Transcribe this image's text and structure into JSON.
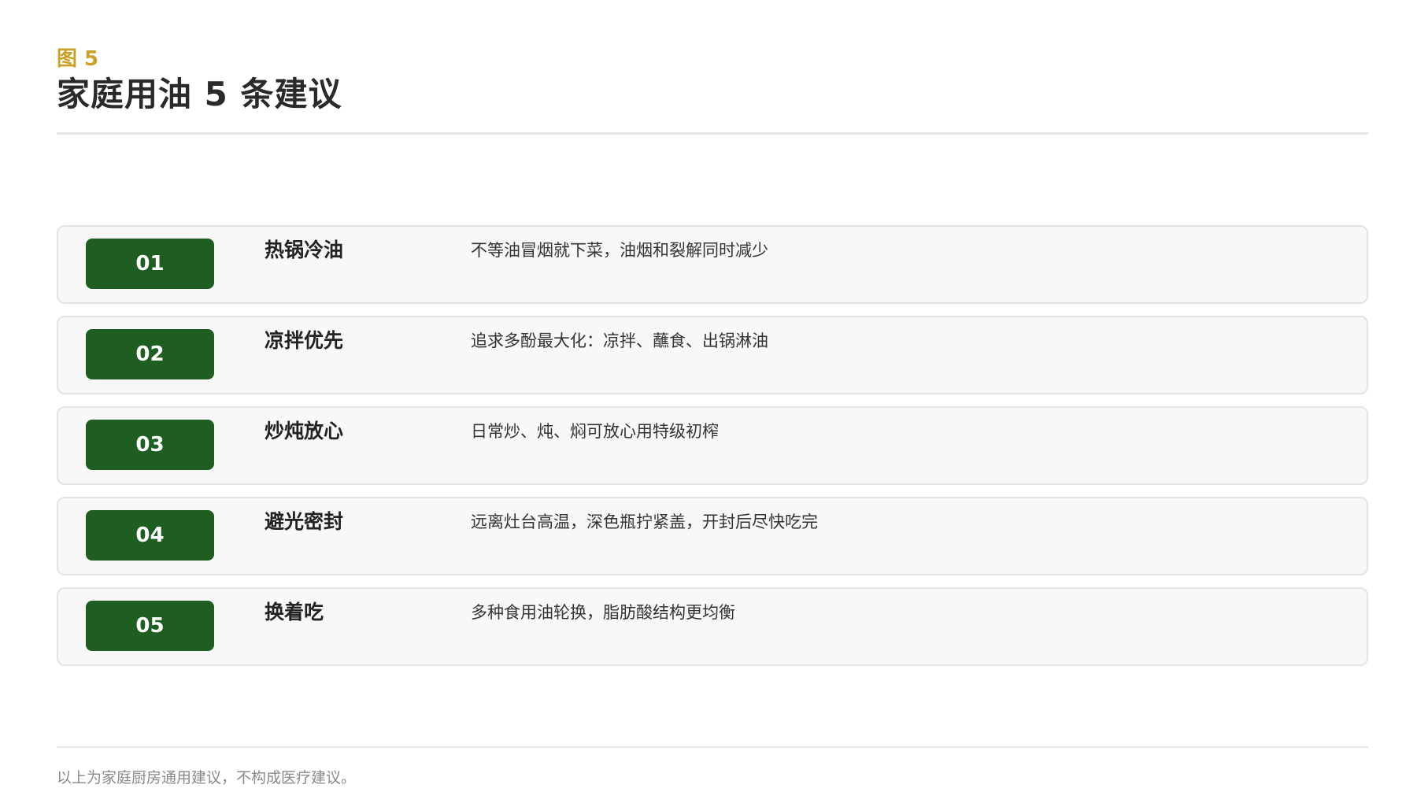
{
  "header": {
    "figure_label": "图 5",
    "title": "家庭用油 5 条建议"
  },
  "colors": {
    "accent_gold": "#c9a227",
    "badge_green": "#1e5e20",
    "row_background": "#f8f8f8"
  },
  "items": [
    {
      "number": "01",
      "title": "热锅冷油",
      "description": "不等油冒烟就下菜，油烟和裂解同时减少"
    },
    {
      "number": "02",
      "title": "凉拌优先",
      "description": "追求多酚最大化：凉拌、蘸食、出锅淋油"
    },
    {
      "number": "03",
      "title": "炒炖放心",
      "description": "日常炒、炖、焖可放心用特级初榨"
    },
    {
      "number": "04",
      "title": "避光密封",
      "description": "远离灶台高温，深色瓶拧紧盖，开封后尽快吃完"
    },
    {
      "number": "05",
      "title": "换着吃",
      "description": "多种食用油轮换，脂肪酸结构更均衡"
    }
  ],
  "footer": {
    "note": "以上为家庭厨房通用建议，不构成医疗建议。"
  }
}
